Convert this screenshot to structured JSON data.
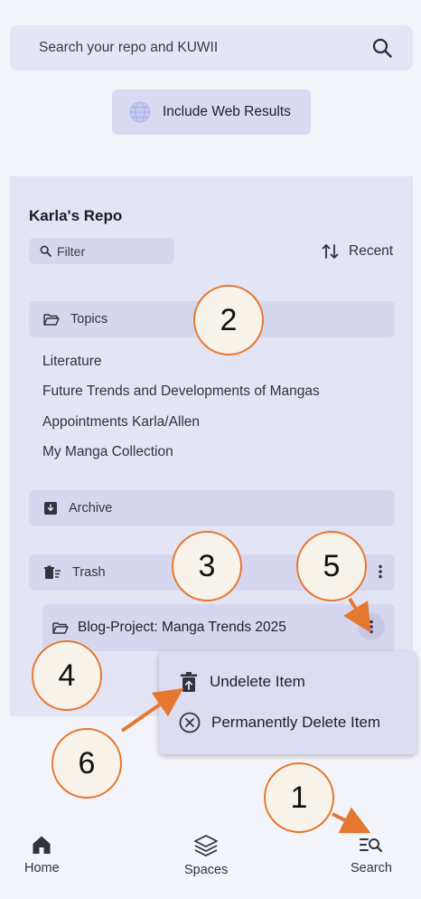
{
  "search": {
    "placeholder": "Search your repo and KUWII",
    "icon": "search-icon"
  },
  "web_results": {
    "label": "Include Web Results",
    "icon": "globe-icon"
  },
  "repo": {
    "title": "Karla's Repo",
    "filter_placeholder": "Filter",
    "sort_label": "Recent",
    "sections": {
      "topics": {
        "label": "Topics",
        "icon": "folder-open-icon"
      },
      "archive": {
        "label": "Archive",
        "icon": "archive-icon"
      },
      "trash": {
        "label": "Trash",
        "icon": "trash-icon"
      }
    },
    "topic_items": [
      "Literature",
      "Future Trends and Developments of Mangas",
      "Appointments Karla/Allen",
      "My Manga Collection"
    ],
    "trash_item": {
      "label": "Blog-Project: Manga Trends 2025",
      "icon": "folder-open-icon"
    }
  },
  "context_menu": {
    "undelete": "Undelete Item",
    "permanent_delete": "Permanently Delete Item"
  },
  "bottom_nav": {
    "home": "Home",
    "spaces": "Spaces",
    "search": "Search"
  },
  "annotations": [
    "1",
    "2",
    "3",
    "4",
    "5",
    "6"
  ],
  "colors": {
    "accent_annotation": "#e6772e",
    "panel": "#e3e4f4",
    "row": "#d6d7ee"
  }
}
